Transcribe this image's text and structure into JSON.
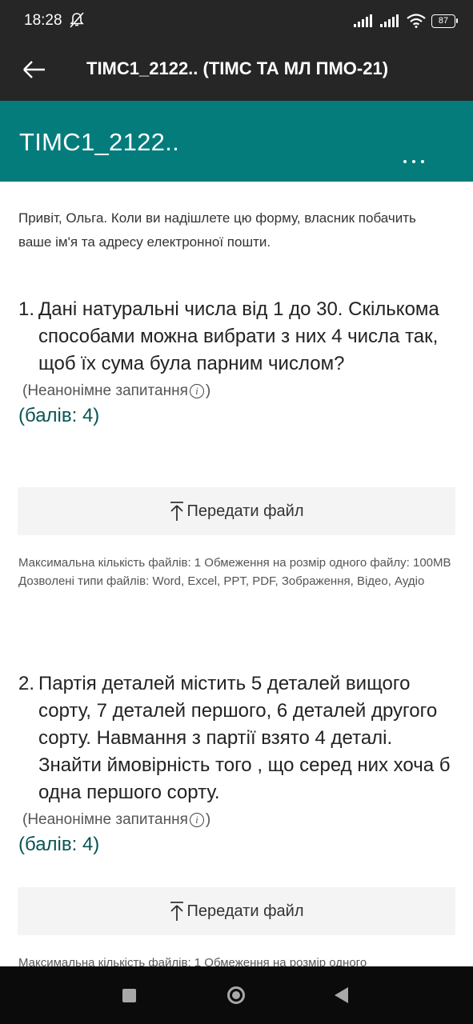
{
  "status_bar": {
    "time": "18:28",
    "battery": "87"
  },
  "app_bar": {
    "title": "ТІМС1_2122.. (ТІМС ТА МЛ ПМО-21)"
  },
  "form_header": {
    "title": "ТІМС1_2122.."
  },
  "greeting": "Привіт, Ольга. Коли ви надішлете цю форму, власник побачить ваше ім'я та адресу електронної пошти.",
  "questions": [
    {
      "number": "1.",
      "text": "Дані натуральні числа від 1 до 30. Скількома способами можна вибрати  з них 4 числа так, щоб їх сума була парним числом?",
      "meta_open": "(Неанонімне запитання",
      "meta_close": ")",
      "points": "(балів: 4)",
      "upload_label": "Передати файл",
      "limits": "Максимальна кількість файлів: 1    Обмеження на розмір одного файлу: 100MB    Дозволені типи файлів: Word, Excel, PPT, PDF, Зображення, Відео, Аудіо"
    },
    {
      "number": "2.",
      "text": " Партія деталей  містить 5 деталей вищого сорту, 7 деталей першого, 6 деталей другого сорту. Навмання з партії взято 4 деталі. Знайти ймовірність того , що серед них хоча б одна першого сорту.",
      "meta_open": "(Неанонімне запитання",
      "meta_close": ")",
      "points": "(балів: 4)",
      "upload_label": "Передати файл",
      "limits": "Максимальна кількість файлів: 1    Обмеження на розмір одного"
    }
  ],
  "colors": {
    "app_bar": "#262626",
    "header_teal": "#047c7c",
    "points_text": "#0b5454",
    "nav_bar": "#0b0b0b"
  },
  "icons": {
    "back": "arrow-left",
    "more": "ellipsis-horizontal",
    "info": "info-circle",
    "upload": "upload-arrow",
    "nav": [
      "square",
      "circle",
      "triangle-left"
    ]
  }
}
